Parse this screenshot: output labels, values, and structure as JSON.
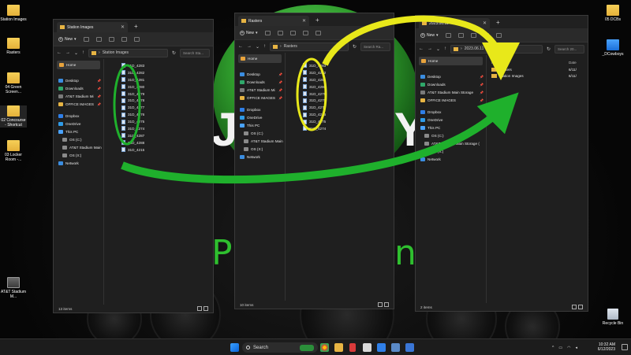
{
  "desktop": {
    "icons_left": [
      {
        "label": "Station Images",
        "type": "folder"
      },
      {
        "label": "Rasters",
        "type": "folder"
      },
      {
        "label": "04 Green Screen...",
        "type": "folder"
      },
      {
        "label": "02 Concourse - Shortcut",
        "type": "folder"
      },
      {
        "label": "03 Locker Room -...",
        "type": "folder"
      },
      {
        "label": "AT&T Stadium M...",
        "type": "drive"
      }
    ],
    "icons_right": [
      {
        "label": "05 DCBs",
        "type": "folder"
      },
      {
        "label": "_DCowboys",
        "type": "pc"
      },
      {
        "label": "Recycle Bin",
        "type": "bin"
      }
    ],
    "wallpaper_accent": "#2f9c2c"
  },
  "windows": [
    {
      "tab_title": "Station Images",
      "new_label": "New",
      "address": "Station Images",
      "search_placeholder": "Search Sta...",
      "nav": {
        "home": "Home",
        "quick": [
          {
            "label": "Desktop",
            "pinned": true
          },
          {
            "label": "Downloads",
            "pinned": true
          },
          {
            "label": "AT&T Stadium Mi",
            "pinned": true
          },
          {
            "label": "OFFICE IMAGES",
            "pinned": true
          }
        ],
        "tree": [
          {
            "label": "Dropbox",
            "level": 0
          },
          {
            "label": "OneDrive",
            "level": 0
          },
          {
            "label": "This PC",
            "level": 0
          },
          {
            "label": "OS (C:)",
            "level": 1
          },
          {
            "label": "AT&T Stadium Main",
            "level": 1
          },
          {
            "label": "OS (X:)",
            "level": 1
          },
          {
            "label": "Network",
            "level": 0
          }
        ]
      },
      "files": [
        "31D_4283",
        "31D_4282",
        "31D_4281",
        "31D_4280",
        "31D_4279",
        "31D_4278",
        "31D_4277",
        "31D_4276",
        "31D_4275",
        "31D_4274",
        "31D_4287",
        "31D_4288",
        "31D_4215"
      ],
      "status": "13 items"
    },
    {
      "tab_title": "Rasters",
      "new_label": "New",
      "address": "Rasters",
      "search_placeholder": "Search Ra...",
      "nav": {
        "home": "Home",
        "quick": [
          {
            "label": "Desktop",
            "pinned": true
          },
          {
            "label": "Downloads",
            "pinned": true
          },
          {
            "label": "AT&T Stadium Mi",
            "pinned": true
          },
          {
            "label": "OFFICE IMAGES",
            "pinned": true
          }
        ],
        "tree": [
          {
            "label": "Dropbox",
            "level": 0
          },
          {
            "label": "OneDrive",
            "level": 0
          },
          {
            "label": "This PC",
            "level": 0
          },
          {
            "label": "OS (C:)",
            "level": 1
          },
          {
            "label": "AT&T Stadium Main",
            "level": 1
          },
          {
            "label": "OS (X:)",
            "level": 1
          },
          {
            "label": "Network",
            "level": 0
          }
        ]
      },
      "files": [
        "31D_4283",
        "31D_4282",
        "31D_4281",
        "31D_4280",
        "31D_4279",
        "31D_4278",
        "31D_4277",
        "31D_4276",
        "31D_4275",
        "31D_4274"
      ],
      "status": "10 items"
    },
    {
      "tab_title": "2023.06.11",
      "new_label": "New",
      "address": "2023.06.11",
      "search_placeholder": "Search 20...",
      "nav": {
        "home": "Home",
        "quick": [
          {
            "label": "Desktop",
            "pinned": true
          },
          {
            "label": "Downloads",
            "pinned": true
          },
          {
            "label": "AT&T Stadium Main Storage",
            "pinned": true
          },
          {
            "label": "OFFICE IMAGES",
            "pinned": true
          }
        ],
        "tree": [
          {
            "label": "Dropbox",
            "level": 0
          },
          {
            "label": "OneDrive",
            "level": 0
          },
          {
            "label": "This PC",
            "level": 0
          },
          {
            "label": "OS (C:)",
            "level": 1
          },
          {
            "label": "AT&T Stadium Main Storage (",
            "level": 1
          },
          {
            "label": "OS (X:)",
            "level": 1
          },
          {
            "label": "Network",
            "level": 0
          }
        ]
      },
      "columns": {
        "name": "Name",
        "date": "Date"
      },
      "folders": [
        {
          "name": "Rasters",
          "date": "6/11/"
        },
        {
          "name": "Station Images",
          "date": "6/11/"
        }
      ],
      "status": "2 items"
    }
  ],
  "taskbar": {
    "search_label": "Search",
    "time": "10:32 AM",
    "date": "6/12/2023"
  },
  "annotations": {
    "yellow": "#e8e81a",
    "green": "#1fb02c"
  }
}
